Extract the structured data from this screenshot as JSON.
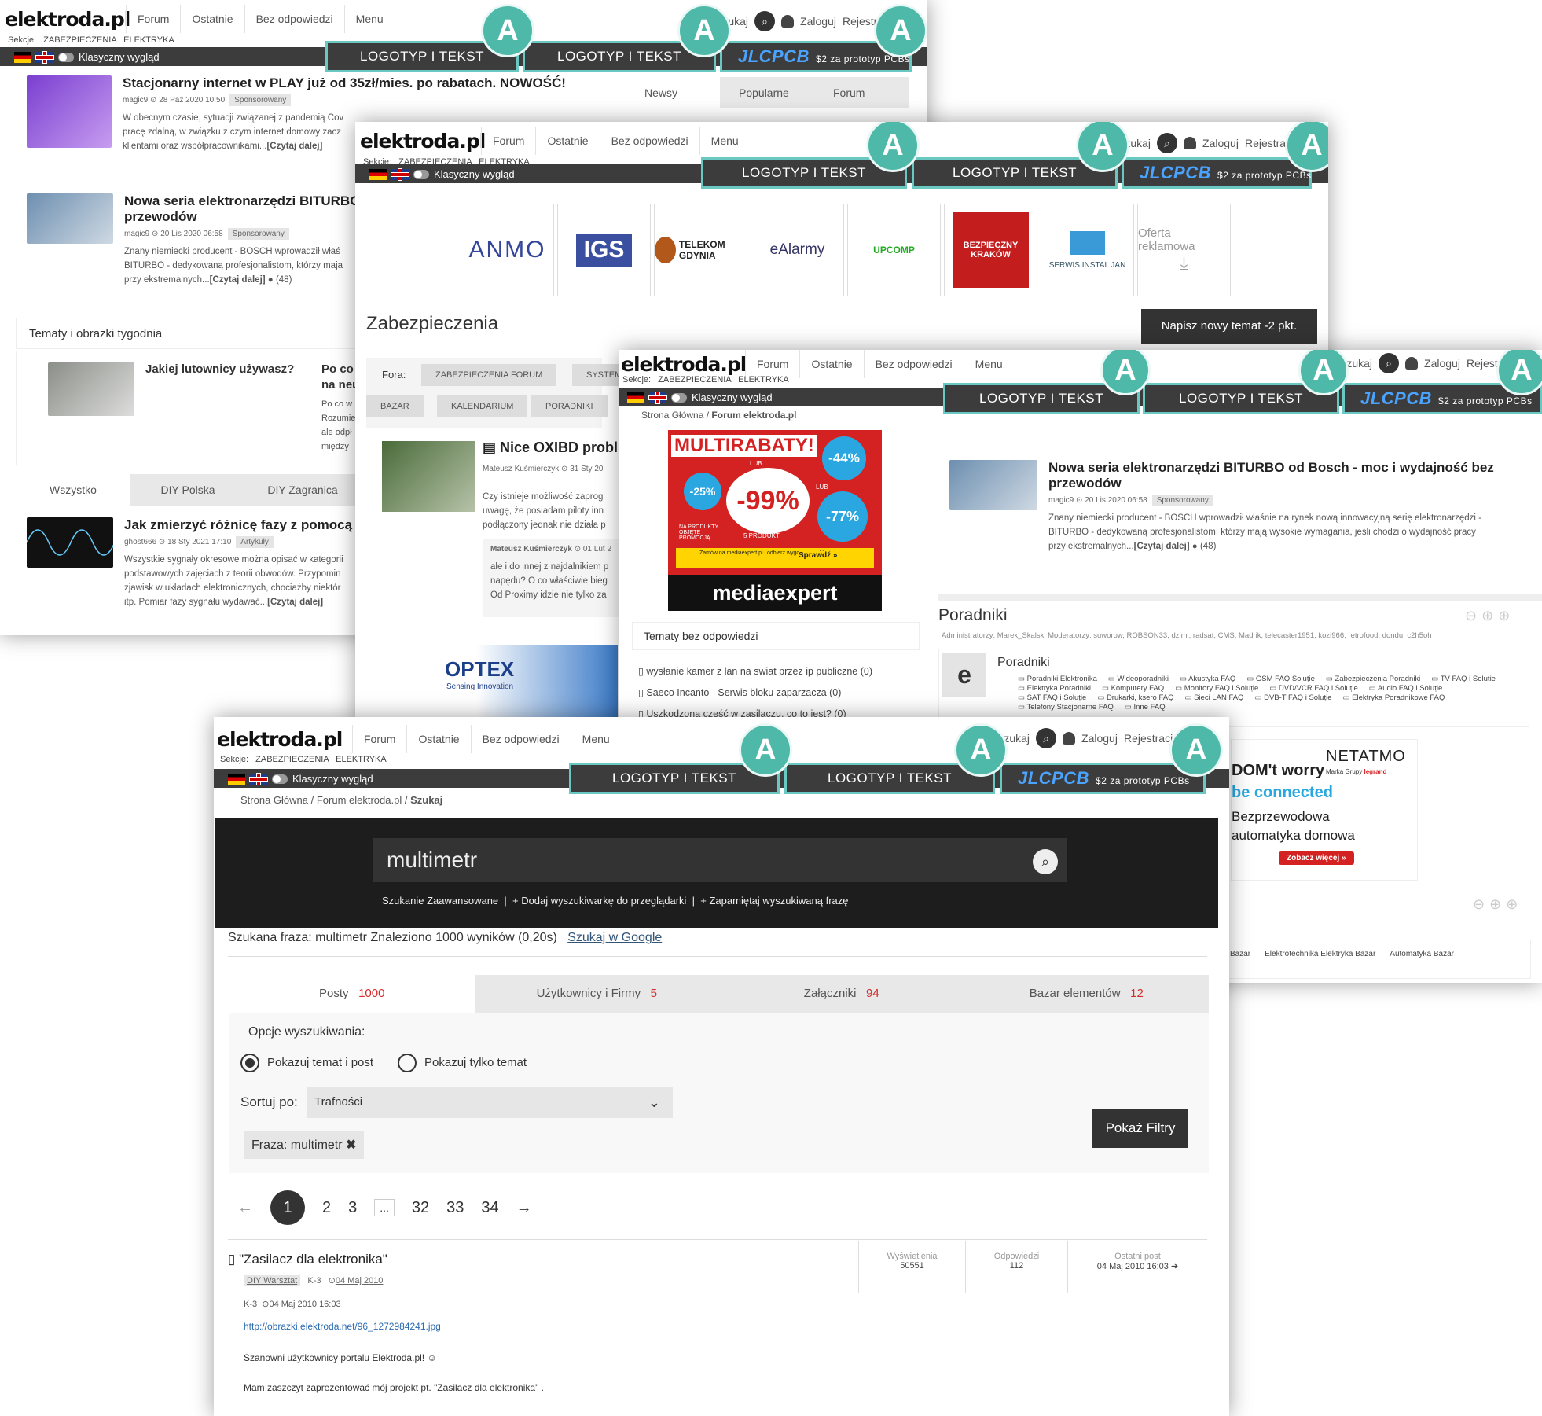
{
  "common": {
    "logo": "elektroda.pl",
    "nav": [
      "Forum",
      "Ostatnie",
      "Bez odpowiedzi",
      "Menu"
    ],
    "sections_label": "Sekcje:",
    "sections": [
      "ZABEZPIECZENIA",
      "ELEKTRYKA"
    ],
    "search_label": "Szukaj",
    "login": "Zaloguj",
    "register": "Rejestracja",
    "classic_view": "Klasyczny wygląd",
    "ad_logotyp": "LOGOTYP I TEKST",
    "ad_jlcpcb": "JLCPCB",
    "ad_jlcpcb_sub": "$2 za prototyp PCBs",
    "badge": "A"
  },
  "win1": {
    "side_tabs": [
      "Newsy",
      "Popularne",
      "Forum"
    ],
    "articles": [
      {
        "title": "Stacjonarny internet w PLAY już od 35zł/mies. po rabatach. NOWOŚĆ!",
        "author": "magic9",
        "date": "28 Paź 2020 10:50",
        "tag": "Sponsorowany",
        "text": "W obecnym czasie, sytuacji związanej z pandemią Cov",
        "text2": "pracę zdalną, w związku z czym internet domowy zacz",
        "text3": "klientami oraz współpracownikami...",
        "more": "[Czytaj dalej]"
      },
      {
        "title": "Nowa seria elektronarzędzi BITURBO",
        "title2": "przewodów",
        "author": "magic9",
        "date": "20 Lis 2020 06:58",
        "tag": "Sponsorowany",
        "text": "Znany niemiecki producent - BOSCH wprowadził właś",
        "text2": "BITURBO - dedykowaną profesjonalistom, którzy maja",
        "text3": "przy ekstremalnych...",
        "more": "[Czytaj dalej]",
        "comments": "(48)"
      }
    ],
    "week_header": "Tematy i obrazki tygodnia",
    "week_item1": "Jakiej lutownicy używasz?",
    "week_item2": "Po co w",
    "week_item2b": "na neu",
    "week_item2_text": [
      "Po co w",
      "Rozumie",
      "ale odpł",
      "między"
    ],
    "cat_tabs": [
      "Wszystko",
      "DIY Polska",
      "DIY Zagranica"
    ],
    "article3": {
      "title": "Jak zmierzyć różnicę fazy z pomocą o",
      "author": "ghost666",
      "date": "18 Sty 2021 17:10",
      "tag": "Artykuły",
      "text": "Wszystkie sygnały okresowe można opisać w kategorii",
      "text2": "podstawowych zajęciach z teorii obwodów. Przypomin",
      "text3": "zjawisk w układach elektronicznych, chociażby niektór",
      "text4": "itp. Pomiar fazy sygnału wydawać...",
      "more": "[Czytaj dalej]"
    }
  },
  "win2": {
    "banners": [
      "ANMO",
      "IGS",
      "TELEKOM GDYNIA",
      "eAlarmy",
      "UPCOMP",
      "BEZPIECZNY KRAKÓW",
      "SERWIS INSTAL JAN",
      "Oferta reklamowa"
    ],
    "page_title": "Zabezpieczenia",
    "new_topic": "Napisz nowy temat -2 pkt.",
    "fora_label": "Fora:",
    "fora": [
      "ZABEZPIECZENIA FORUM",
      "SYSTEMY"
    ],
    "fora2": [
      "BAZAR",
      "KALENDARIUM",
      "PORADNIKI"
    ],
    "post_title": "Nice OXIBD probl",
    "post_author": "Mateusz Kuśmierczyk",
    "post_date": "31 Sty 20",
    "post_text": [
      "Czy istnieje możliwość zaprog",
      "uwagę, że posiadam piloty inn",
      "podłączony jednak nie działa p"
    ],
    "reply_author": "Mateusz Kuśmierczyk",
    "reply_date": "01 Lut 2",
    "reply_text": [
      "ale i do innej z najdalnikiem p",
      "napędu? O co właściwie bieg",
      "Od Proximy idzie nie tylko za"
    ],
    "optex": "OPTEX",
    "optex_sub": "Sensing Innovation"
  },
  "win3": {
    "breadcrumb": [
      "Strona Główna",
      "Forum elektroda.pl"
    ],
    "mx_title": "MULTIRABATY!",
    "mx_nums": [
      "-44%",
      "-25%",
      "-99%",
      "-77%"
    ],
    "mx_small": [
      "NA PRODUKTY OBJĘTE PROMOCJĄ",
      "LUB",
      "5 PRODUKT",
      "LUB"
    ],
    "mx_order": "Zamów na mediaexpert.pl i odbierz wygodnie w sklepie!",
    "mx_check": "Sprawdź »",
    "mx_brand": "mediaexpert",
    "unanswered_header": "Tematy bez odpowiedzi",
    "unanswered": [
      "wysłanie kamer z lan na swiat przez ip publiczne (0)",
      "Saeco Incanto - Serwis bloku zaparzacza (0)",
      "Uszkodzona część w zasilaczu, co to jest? (0)"
    ],
    "article": {
      "title": "Nowa seria elektronarzędzi BITURBO od Bosch - moc i wydajność bez",
      "title2": "przewodów",
      "author": "magic9",
      "date": "20 Lis 2020 06:58",
      "tag": "Sponsorowany",
      "text": "Znany niemiecki producent - BOSCH wprowadził właśnie na rynek nową innowacyjną serię elektronarzędzi -",
      "text2": "BITURBO - dedykowaną profesjonalistom, którzy mają wysokie wymagania, jeśli chodzi o wydajność pracy",
      "text3": "przy ekstremalnych...",
      "more": "[Czytaj dalej]",
      "comments": "(48)"
    },
    "poradniki_title": "Poradniki",
    "admins": "Administratorzy: Marek_Skalski Moderatorzy: suworow, ROBSON33, dzimi, radsat, CMS, Madrik, telecaster1951, kozi966, retrofood, dondu, c2h5oh",
    "poradniki_sub": "Poradniki",
    "links": [
      "Poradniki Elektronika",
      "Wideoporadniki",
      "Akustyka FAQ",
      "GSM FAQ Soluție",
      "Zabezpieczenia Poradniki",
      "TV FAQ i Soluție",
      "Elektryka Poradniki",
      "Komputery FAQ",
      "Monitory FAQ i Soluție",
      "DVD/VCR FAQ i Soluție",
      "Audio FAQ i Soluție",
      "SAT FAQ i Soluție",
      "Drukarki, ksero FAQ",
      "Sieci LAN FAQ",
      "DVB-T FAQ i Soluție",
      "Elektryka Poradnikowe FAQ",
      "Telefony Stacjonarne FAQ",
      "Inne FAQ"
    ],
    "netatmo": "NETATMO",
    "netatmo_sub": "Marka Grupy",
    "legrand": "legrand",
    "net_l1": "DOM't worry",
    "net_l2": "be connected",
    "net_l3": "Bezprzewodowa",
    "net_l4": "automatyka domowa",
    "net_btn": "Zobacz więcej »",
    "bazar_links": [
      "Bazar",
      "Elektrotechnika Elektryka Bazar",
      "Automatyka Bazar"
    ]
  },
  "win4": {
    "breadcrumb": [
      "Strona Główna",
      "Forum elektroda.pl",
      "Szukaj"
    ],
    "query": "multimetr",
    "search_links": [
      "Szukanie Zaawansowane",
      "+ Dodaj wyszukiwarkę do przeglądarki",
      "+ Zapamiętaj wyszukiwaną frazę"
    ],
    "result_info": "Szukana fraza: multimetr Znaleziono 1000 wyników (0,20s)",
    "google_link": "Szukaj w Google",
    "result_tabs": [
      {
        "label": "Posty",
        "count": "1000"
      },
      {
        "label": "Użytkownicy i Firmy",
        "count": "5"
      },
      {
        "label": "Załączniki",
        "count": "94"
      },
      {
        "label": "Bazar elementów",
        "count": "12"
      }
    ],
    "options_label": "Opcje wyszukiwania:",
    "radio1": "Pokazuj temat i post",
    "radio2": "Pokazuj tylko temat",
    "sort_label": "Sortuj po:",
    "sort_value": "Trafności",
    "show_filters": "Pokaż Filtry",
    "phrase_chip": "Fraza: multimetr",
    "pages": [
      "1",
      "2",
      "3",
      "...",
      "32",
      "33",
      "34"
    ],
    "result": {
      "title": "\"Zasilacz dla elektronika\"",
      "forum": "DIY Warsztat",
      "author": "K-3",
      "date": "04 Maj 2010",
      "views_label": "Wyświetlenia",
      "views": "50551",
      "replies_label": "Odpowiedzi",
      "replies": "112",
      "last_label": "Ostatni post",
      "last": "04 Maj 2010 16:03",
      "post_author": "K-3",
      "post_date": "04 Maj 2010 16:03",
      "link": "http://obrazki.elektroda.net/96_1272984241.jpg",
      "greeting": "Szanowni użytkownicy portalu Elektroda.pl!",
      "body": "Mam zaszczyt zaprezentować mój projekt pt. \"Zasilacz dla elektronika\" ."
    }
  },
  "colors": {
    "accent": "#4fb9a9",
    "dark_bar": "#3c3c3c",
    "search_bg": "#1d1d1d",
    "count_red": "#d62b2b",
    "jlcpcb_blue": "#4aa3ff"
  }
}
